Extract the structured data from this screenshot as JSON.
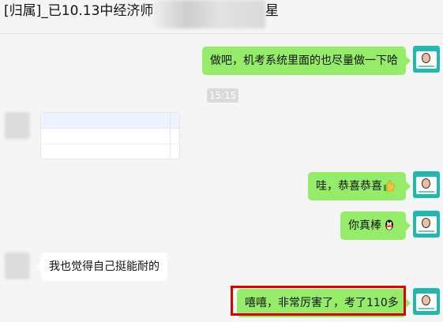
{
  "header": {
    "title": "[归属]_已10.13中经济师",
    "title_tail": "星"
  },
  "messages": [
    {
      "side": "right",
      "text": "做吧，机考系统里面的也尽量做一下哈"
    },
    {
      "side": "time",
      "text": "15:15"
    },
    {
      "side": "left",
      "type": "card"
    },
    {
      "side": "right",
      "text": "哇，恭喜恭喜",
      "icon": "thumbs-up-icon"
    },
    {
      "side": "right",
      "text": "你真棒",
      "icon": "qq-penguin-icon"
    },
    {
      "side": "left",
      "text": "我也觉得自己挺能耐的"
    },
    {
      "side": "right",
      "text": "嘻嘻，非常厉害了，考了110多",
      "highlighted": true
    }
  ],
  "colors": {
    "bubble_self": "#95ec69",
    "bubble_other": "#ffffff",
    "highlight": "#e00000"
  }
}
